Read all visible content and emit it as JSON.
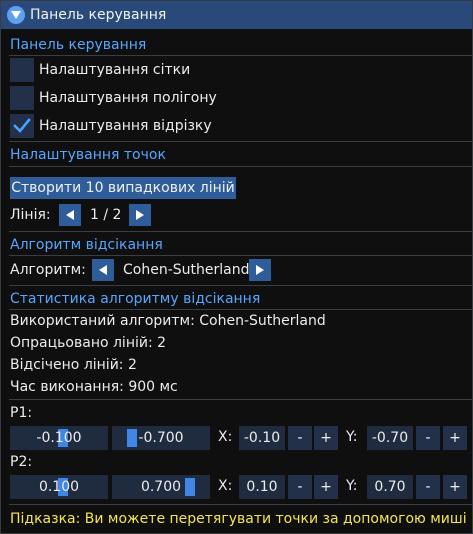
{
  "window": {
    "title": "Панель керування",
    "colors": {
      "titlebar": "#29497a",
      "header_text": "#58a6ff",
      "button": "#2f5d99",
      "field": "#1f2b3f",
      "hint": "#f5e553"
    }
  },
  "panel": {
    "header": "Панель керування",
    "checkboxes": [
      {
        "label": "Налаштування сітки",
        "checked": false
      },
      {
        "label": "Налаштування полігону",
        "checked": false
      },
      {
        "label": "Налаштування відрізку",
        "checked": true
      }
    ]
  },
  "points": {
    "header": "Налаштування точок",
    "random_button": "Створити 10 випадкових ліній",
    "line_label": "Лінія:",
    "line_counter": "1 / 2"
  },
  "clipping": {
    "header": "Алгоритм відсікання",
    "algorithm_label": "Алгоритм:",
    "algorithm_value": "Cohen-Sutherland"
  },
  "stats": {
    "header": "Статистика алгоритму відсікання",
    "used_algorithm": "Використаний алгоритм: Cohen-Sutherland",
    "processed": "Опрацьовано ліній: 2",
    "clipped": "Відсічено ліній: 2",
    "exec_time": "Час виконання: 900 мс"
  },
  "p1": {
    "label": "P1:",
    "slider_x": "-0.100",
    "slider_y": "-0.700",
    "x_label": "X:",
    "x_value": "-0.10",
    "y_label": "Y:",
    "y_value": "-0.70",
    "minus": "-",
    "plus": "+"
  },
  "p2": {
    "label": "P2:",
    "slider_x": "0.100",
    "slider_y": "0.700",
    "x_label": "X:",
    "x_value": "0.10",
    "y_label": "Y:",
    "y_value": "0.70",
    "minus": "-",
    "plus": "+"
  },
  "hint": "Підказка: Ви можете перетягувати точки за допомогою миші",
  "icons": {
    "collapse": "triangle-down-icon",
    "check": "checkmark-icon",
    "prev": "arrow-left-icon",
    "next": "arrow-right-icon"
  }
}
